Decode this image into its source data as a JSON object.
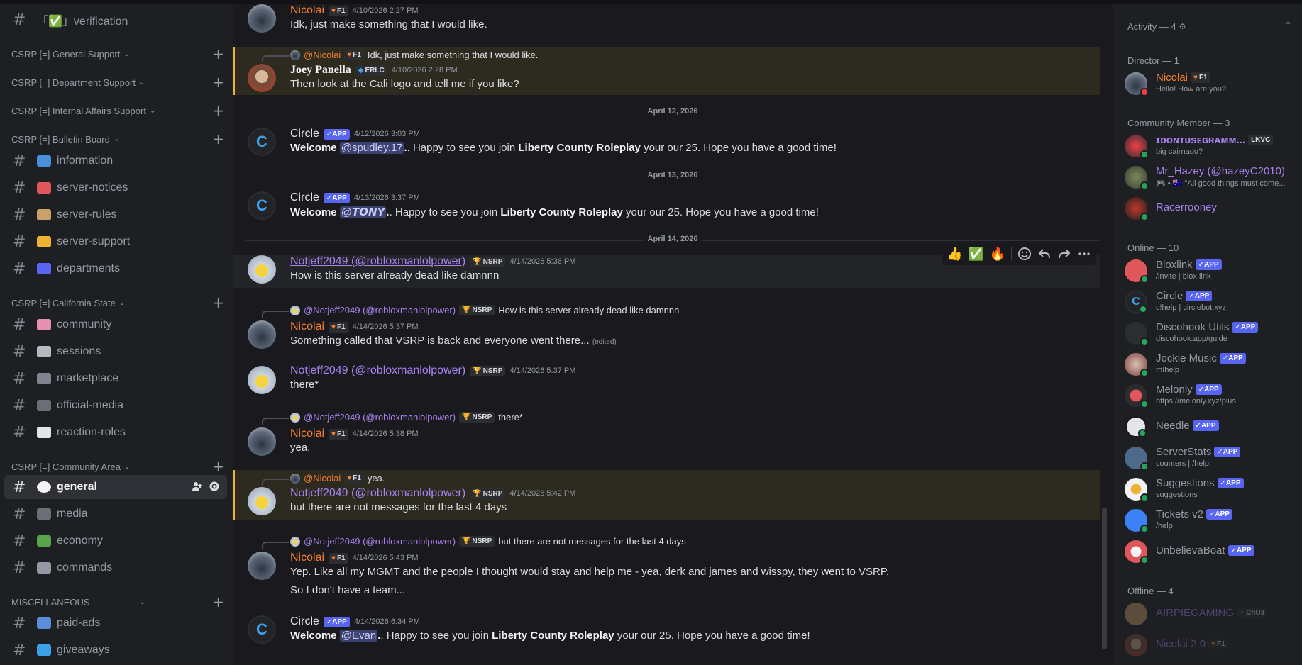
{
  "sidebar": {
    "top_channel": "「✅」verification",
    "categories": [
      {
        "label": "CSRP [=] General Support"
      },
      {
        "label": "CSRP [=] Department Support"
      },
      {
        "label": "CSRP [=] Internal Affairs Support"
      },
      {
        "label": "CSRP [=] Bulletin Board"
      },
      {
        "label": "CSRP [=] California State"
      },
      {
        "label": "CSRP [=] Community Area"
      },
      {
        "label": "MISCELLANEOUS—————"
      }
    ],
    "channels": [
      {
        "label": "information",
        "icon": "laptop-icon"
      },
      {
        "label": "server-notices",
        "icon": "megaphone-icon"
      },
      {
        "label": "server-rules",
        "icon": "clipboard-icon"
      },
      {
        "label": "server-support",
        "icon": "ticket-icon"
      },
      {
        "label": "departments",
        "icon": "police-light-icon"
      },
      {
        "label": "community",
        "icon": "castle-icon"
      },
      {
        "label": "sessions",
        "icon": "mic-icon"
      },
      {
        "label": "marketplace",
        "icon": "cart-icon"
      },
      {
        "label": "official-media",
        "icon": "camera-icon"
      },
      {
        "label": "reaction-roles",
        "icon": "page-icon"
      },
      {
        "label": "general",
        "icon": "speech-bubble-icon"
      },
      {
        "label": "media",
        "icon": "camera-icon"
      },
      {
        "label": "economy",
        "icon": "cash-icon"
      },
      {
        "label": "commands",
        "icon": "wrench-icon"
      },
      {
        "label": "paid-ads",
        "icon": "credit-card-icon"
      },
      {
        "label": "giveaways",
        "icon": "gem-icon"
      }
    ]
  },
  "chat": {
    "dividers": [
      "April 12, 2026",
      "April 13, 2026",
      "April 14, 2026"
    ],
    "messages": [
      {
        "author": "Nicolai",
        "tag": "F1",
        "time": "4/10/2026 2:27 PM",
        "text": "Idk, just make something that I would like."
      },
      {
        "reply_author": "@Nicolai",
        "reply_tag": "F1",
        "reply_text": "Idk, just make something that I would like.",
        "author": "Joey Panella",
        "tag": "ERLC",
        "time": "4/10/2026 2:28 PM",
        "text": "Then look at the Cali logo and tell me if you like?"
      },
      {
        "author": "Circle",
        "badge": "APP",
        "time": "4/12/2026 3:03 PM",
        "pre": "Welcome",
        "mention": "@spudley.17",
        "mid": ". Happy to see you join ",
        "bold": "Liberty County Roleplay",
        "post": " your our 25. Hope you have a good time!"
      },
      {
        "author": "Circle",
        "badge": "APP",
        "time": "4/13/2026 3:37 PM",
        "pre": "Welcome",
        "mention": "@𝙏𝙊𝙉𝙔",
        "mid": ". Happy to see you join ",
        "bold": "Liberty County Roleplay",
        "post": " your our 25. Hope you have a good time!"
      },
      {
        "author": "Notjeff2049 (@robloxmanlolpower)",
        "tag": "NSRP",
        "time": "4/14/2026 5:36 PM",
        "text": "How is this server already dead like damnnn"
      },
      {
        "reply_author": "@Notjeff2049 (@robloxmanlolpower)",
        "reply_tag": "NSRP",
        "reply_text": "How is this server already dead like damnnn",
        "author": "Nicolai",
        "tag": "F1",
        "time": "4/14/2026 5:37 PM",
        "text": "Something called that VSRP is back and everyone went there...",
        "edited": "(edited)"
      },
      {
        "author": "Notjeff2049 (@robloxmanlolpower)",
        "tag": "NSRP",
        "time": "4/14/2026 5:37 PM",
        "text": "there*"
      },
      {
        "reply_author": "@Notjeff2049 (@robloxmanlolpower)",
        "reply_tag": "NSRP",
        "reply_text": "there*",
        "author": "Nicolai",
        "tag": "F1",
        "time": "4/14/2026 5:38 PM",
        "text": "yea."
      },
      {
        "reply_author": "@Nicolai",
        "reply_tag": "F1",
        "reply_text": "yea.",
        "author": "Notjeff2049 (@robloxmanlolpower)",
        "tag": "NSRP",
        "time": "4/14/2026 5:42 PM",
        "text": "but there are not messages for the last 4 days"
      },
      {
        "reply_author": "@Notjeff2049 (@robloxmanlolpower)",
        "reply_tag": "NSRP",
        "reply_text": "but there are not messages for the last 4 days",
        "author": "Nicolai",
        "tag": "F1",
        "time": "4/14/2026 5:43 PM",
        "text": "Yep. Like all my MGMT and the people I thought would stay and help me - yea, derk and james and wisspy, they went to VSRP.",
        "text2": "So I don't have a team..."
      },
      {
        "author": "Circle",
        "badge": "APP",
        "time": "4/14/2026 6:34 PM",
        "pre": "Welcome",
        "mention": "@Evan",
        "mid": ". Happy to see you join ",
        "bold": "Liberty County Roleplay",
        "post": " your our 25. Hope you have a good time!"
      }
    ],
    "reactions": [
      "👍",
      "✅",
      "🔥"
    ]
  },
  "members": {
    "activity": "Activity — 4",
    "groups": [
      {
        "title": "Director — 1"
      },
      {
        "title": "Community Member — 3"
      },
      {
        "title": "Online — 10"
      },
      {
        "title": "Offline — 4"
      }
    ],
    "list": [
      {
        "name": "Nicolai",
        "tag": "F1",
        "sub": "Hello! How are you?"
      },
      {
        "name": "ɪᴅᴏɴᴛᴜsᴇɢʀᴀᴍᴍ...",
        "tag": "LKVC",
        "sub": "big cairnado?"
      },
      {
        "name": "Mr_Hazey (@hazeyC2010)",
        "sub": "🎮 • 🇦🇺 \"All good things must come..."
      },
      {
        "name": "Racerrooney",
        "sub": ""
      },
      {
        "name": "Bloxlink",
        "badge": "APP",
        "sub": "/invite | blox.link"
      },
      {
        "name": "Circle",
        "badge": "APP",
        "sub": "c!help | circlebot.xyz"
      },
      {
        "name": "Discohook Utils",
        "badge": "APP",
        "sub": "discohook.app/guide"
      },
      {
        "name": "Jockie Music",
        "badge": "APP",
        "sub": "m!help"
      },
      {
        "name": "Melonly",
        "badge": "APP",
        "sub": "https://melonly.xyz/plus"
      },
      {
        "name": "Needle",
        "badge": "APP",
        "sub": ""
      },
      {
        "name": "ServerStats",
        "badge": "APP",
        "sub": "counters | /help"
      },
      {
        "name": "Suggestions",
        "badge": "APP",
        "sub": "suggestions"
      },
      {
        "name": "Tickets v2",
        "badge": "APP",
        "sub": "/help"
      },
      {
        "name": "UnbelievaBoat",
        "badge": "APP",
        "sub": ""
      },
      {
        "name": "AIRPIEGAMING",
        "tag": "ChU3",
        "sub": ""
      },
      {
        "name": "Nicolai 2.0",
        "tag": "F1",
        "sub": ""
      }
    ]
  }
}
